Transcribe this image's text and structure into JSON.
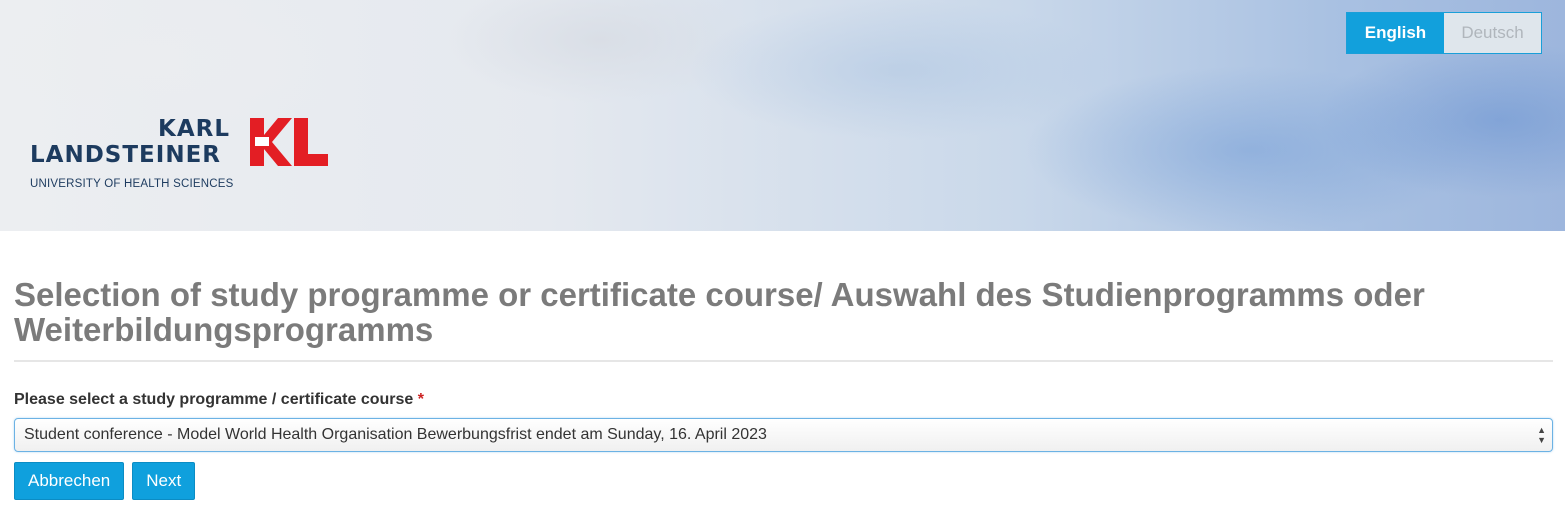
{
  "header": {
    "language_switch": {
      "english_label": "English",
      "deutsch_label": "Deutsch",
      "active": "English"
    },
    "logo": {
      "line1": "KARL",
      "line2": "LANDSTEINER",
      "subtitle": "UNIVERSITY OF HEALTH SCIENCES",
      "mark_icon": "kl-logo-icon",
      "brand_color": "#e31e24",
      "text_color": "#1d3b5f"
    }
  },
  "main": {
    "title": "Selection of study programme or certificate course/ Auswahl des Studienprogramms oder Weiterbildungsprogramms",
    "field": {
      "label": "Please select a study programme / certificate course",
      "required_marker": "*",
      "selected_value": "Student conference - Model World Health Organisation Bewerbungsfrist endet am Sunday, 16. April 2023"
    },
    "buttons": {
      "cancel_label": "Abbrechen",
      "next_label": "Next"
    }
  },
  "colors": {
    "accent": "#12a0dc",
    "title_gray": "#7b7b7b"
  }
}
